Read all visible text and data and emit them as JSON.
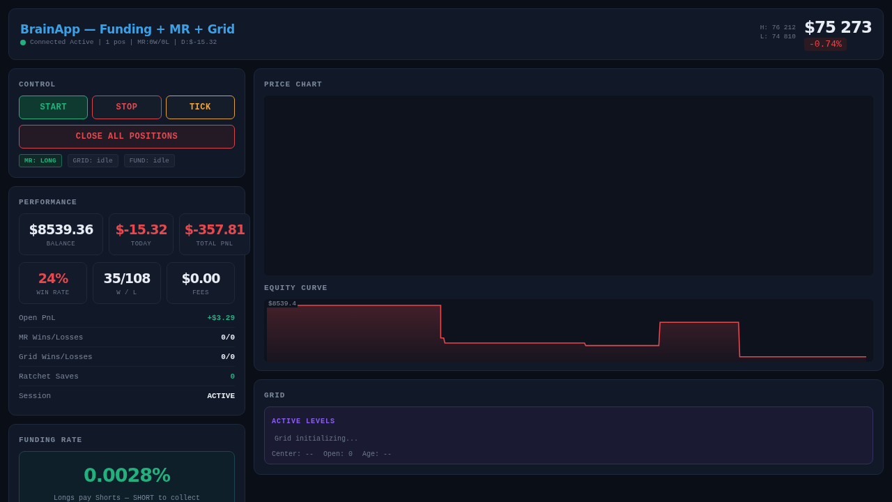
{
  "header": {
    "title": "BrainApp — Funding + MR + Grid",
    "connected": true,
    "connection_label": "Connected",
    "status_line": "Active | 1 pos | MR:0W/0L | D:$-15.32",
    "high": "H: 76 212",
    "low": "L: 74 810",
    "price": "$75 273",
    "change": "-0.74%",
    "change_negative": true
  },
  "control": {
    "title": "CONTROL",
    "buttons": [
      {
        "label": "START",
        "kind": "start"
      },
      {
        "label": "STOP",
        "kind": "stop"
      },
      {
        "label": "TICK",
        "kind": "tick"
      }
    ],
    "close_button": "CLOSE ALL POSITIONS",
    "tags": [
      {
        "label": "MR: LONG",
        "active": true
      },
      {
        "label": "GRID: idle",
        "active": false
      },
      {
        "label": "FUND: idle",
        "active": false
      }
    ]
  },
  "performance": {
    "title": "PERFORMANCE",
    "stats": [
      {
        "value": "$8539.36",
        "label": "BALANCE",
        "color": "#e8edf5"
      },
      {
        "value": "$-15.32",
        "label": "TODAY",
        "color": "#e5484d"
      },
      {
        "value": "$-357.81",
        "label": "TOTAL PNL",
        "color": "#e5484d"
      },
      {
        "value": "24%",
        "label": "WIN RATE",
        "color": "#e5484d"
      },
      {
        "value": "35/108",
        "label": "W / L",
        "color": "#e8edf5"
      },
      {
        "value": "$0.00",
        "label": "FEES",
        "color": "#e8edf5"
      }
    ],
    "rows": [
      {
        "label": "Open PnL",
        "value": "+$3.29",
        "color": "#22b07d"
      },
      {
        "label": "MR Wins/Losses",
        "value": "0/0",
        "color": "#e8edf5"
      },
      {
        "label": "Grid Wins/Losses",
        "value": "0/0",
        "color": "#e8edf5"
      },
      {
        "label": "Ratchet Saves",
        "value": "0",
        "color": "#22b07d"
      },
      {
        "label": "Session",
        "value": "ACTIVE",
        "color": "#e8edf5"
      }
    ]
  },
  "funding": {
    "title": "FUNDING RATE",
    "rate": "0.0028%",
    "rate_positive": true,
    "note": "Longs pay Shorts — SHORT to collect"
  },
  "price_chart": {
    "title": "PRICE CHART"
  },
  "equity": {
    "title": "EQUITY CURVE",
    "max_label": "$8539.4"
  },
  "grid": {
    "title": "GRID",
    "levels_title": "ACTIVE LEVELS",
    "message": "Grid initializing...",
    "center": "Center: --",
    "open": "Open: 0",
    "age": "Age: --"
  }
}
